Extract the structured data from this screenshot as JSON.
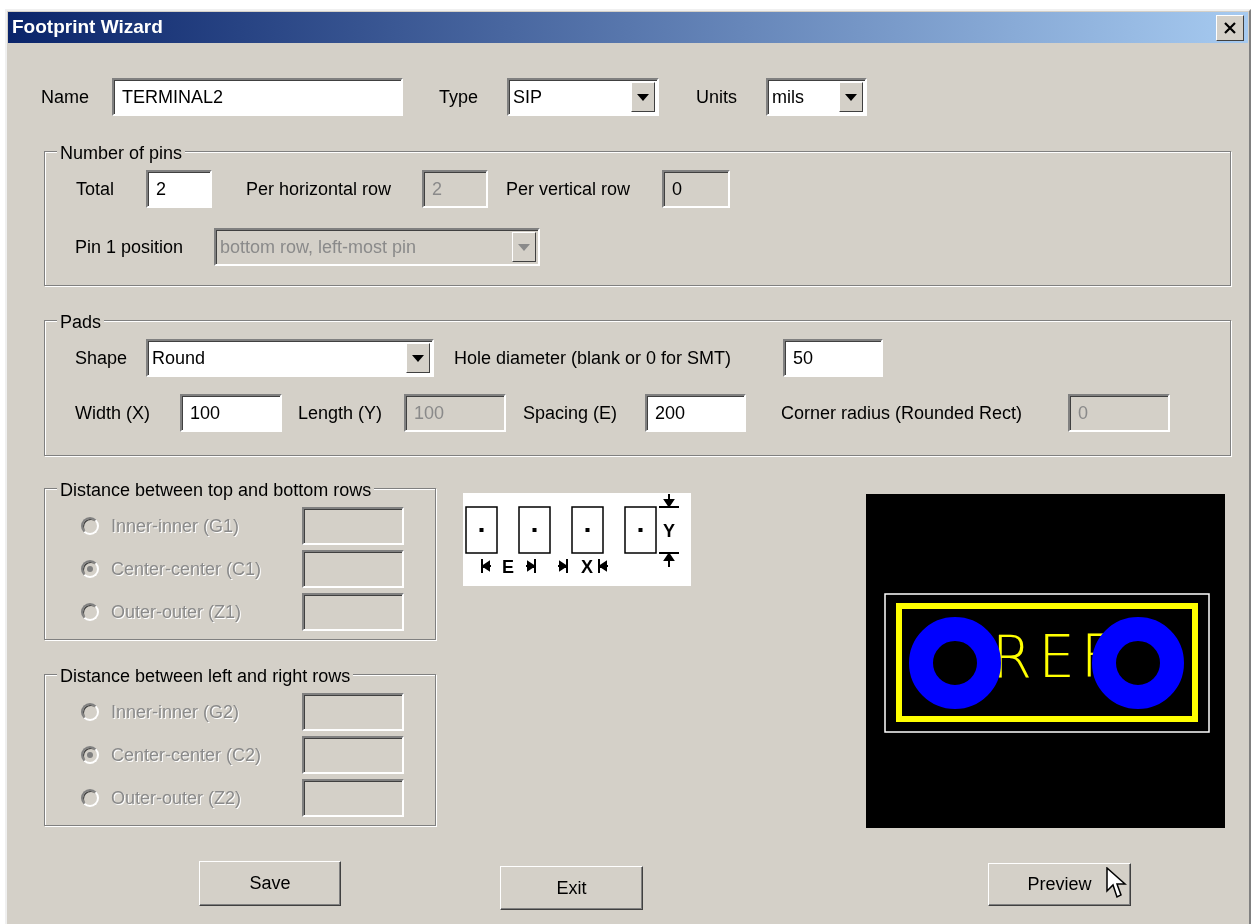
{
  "window": {
    "title": "Footprint Wizard"
  },
  "header": [
    {
      "label": "Name",
      "value": "TERMINAL2",
      "kind": "text",
      "disabled": false,
      "readonly": false
    },
    {
      "label": "Type",
      "value": "SIP",
      "kind": "combo",
      "disabled": false,
      "readonly": false
    },
    {
      "label": "Units",
      "value": "mils",
      "kind": "combo",
      "disabled": false,
      "readonly": false
    }
  ],
  "pins": {
    "title": "Number of pins",
    "fields": [
      {
        "label": "Total",
        "value": "2",
        "kind": "text",
        "disabled": false,
        "readonly": false
      },
      {
        "label": "Per horizontal row",
        "value": "2",
        "kind": "text",
        "disabled": true,
        "readonly": true
      },
      {
        "label": "Per vertical row",
        "value": "0",
        "kind": "text",
        "disabled": false,
        "readonly": true
      },
      {
        "label": "Pin 1 position",
        "value": "bottom row, left-most pin",
        "kind": "combo",
        "disabled": true,
        "readonly": true
      }
    ]
  },
  "pads": {
    "title": "Pads",
    "fields": [
      {
        "label": "Shape",
        "value": "Round",
        "kind": "combo",
        "disabled": false,
        "readonly": false
      },
      {
        "label": "Hole diameter (blank or 0 for SMT)",
        "value": "50",
        "kind": "text",
        "disabled": false,
        "readonly": false
      },
      {
        "label": "Width (X)",
        "value": "100",
        "kind": "text",
        "disabled": false,
        "readonly": false
      },
      {
        "label": "Length (Y)",
        "value": "100",
        "kind": "text",
        "disabled": true,
        "readonly": true
      },
      {
        "label": "Spacing (E)",
        "value": "200",
        "kind": "text",
        "disabled": false,
        "readonly": false
      },
      {
        "label": "Corner radius (Rounded Rect)",
        "value": "0",
        "kind": "text",
        "disabled": true,
        "readonly": true
      }
    ]
  },
  "distance_groups": [
    {
      "title": "Distance between top and bottom rows",
      "disabled": true,
      "options": [
        {
          "label": "Inner-inner (G1)",
          "selected": false
        },
        {
          "label": "Center-center (C1)",
          "selected": true
        },
        {
          "label": "Outer-outer (Z1)",
          "selected": false
        }
      ]
    },
    {
      "title": "Distance between left and right rows",
      "disabled": true,
      "options": [
        {
          "label": "Inner-inner (G2)",
          "selected": false
        },
        {
          "label": "Center-center (C2)",
          "selected": true
        },
        {
          "label": "Outer-outer (Z2)",
          "selected": false
        }
      ]
    }
  ],
  "pad_diagram": {
    "labels": [
      "E",
      "X",
      "Y"
    ]
  },
  "preview": {
    "reference": "REF"
  },
  "buttons": [
    {
      "label": "Save"
    },
    {
      "label": "Exit"
    },
    {
      "label": "Preview"
    }
  ]
}
